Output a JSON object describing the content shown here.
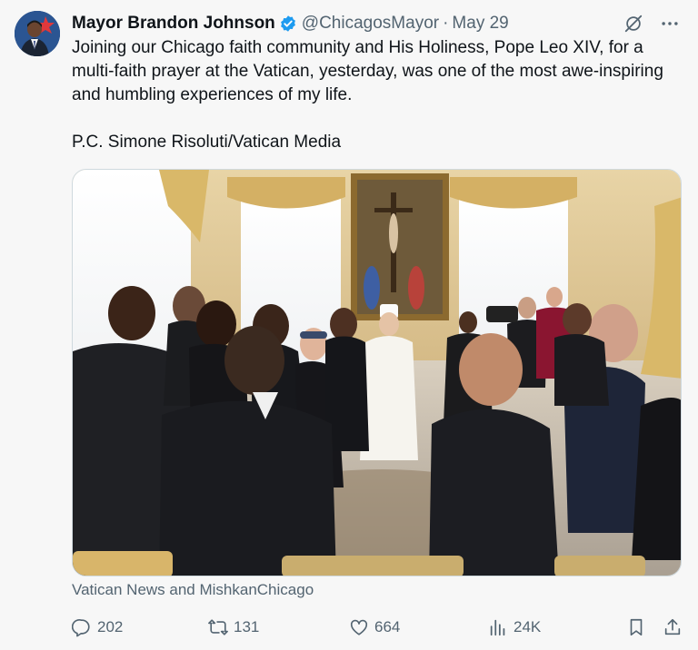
{
  "author": {
    "name": "Mayor Brandon Johnson",
    "handle": "@ChicagosMayor",
    "separator": "·",
    "date": "May 29"
  },
  "post": {
    "text": "Joining our Chicago faith community and His Holiness, Pope Leo XIV, for a multi-faith prayer at the Vatican, yesterday, was one of the most awe-inspiring and humbling experiences of my life.\n\nP.C. Simone Risoluti/Vatican Media",
    "media_caption": "Vatican News and MishkanChicago"
  },
  "actions": {
    "replies": "202",
    "reposts": "131",
    "likes": "664",
    "views": "24K"
  },
  "icons": {
    "verified": "verified-badge-icon",
    "grok": "grok-icon",
    "more": "more-icon",
    "reply": "reply-icon",
    "repost": "repost-icon",
    "like": "like-icon",
    "views": "views-icon",
    "bookmark": "bookmark-icon",
    "share": "share-icon"
  },
  "colors": {
    "verified": "#1d9bf0",
    "text": "#0f1419",
    "secondary": "#536471",
    "background": "#f7f7f7"
  }
}
